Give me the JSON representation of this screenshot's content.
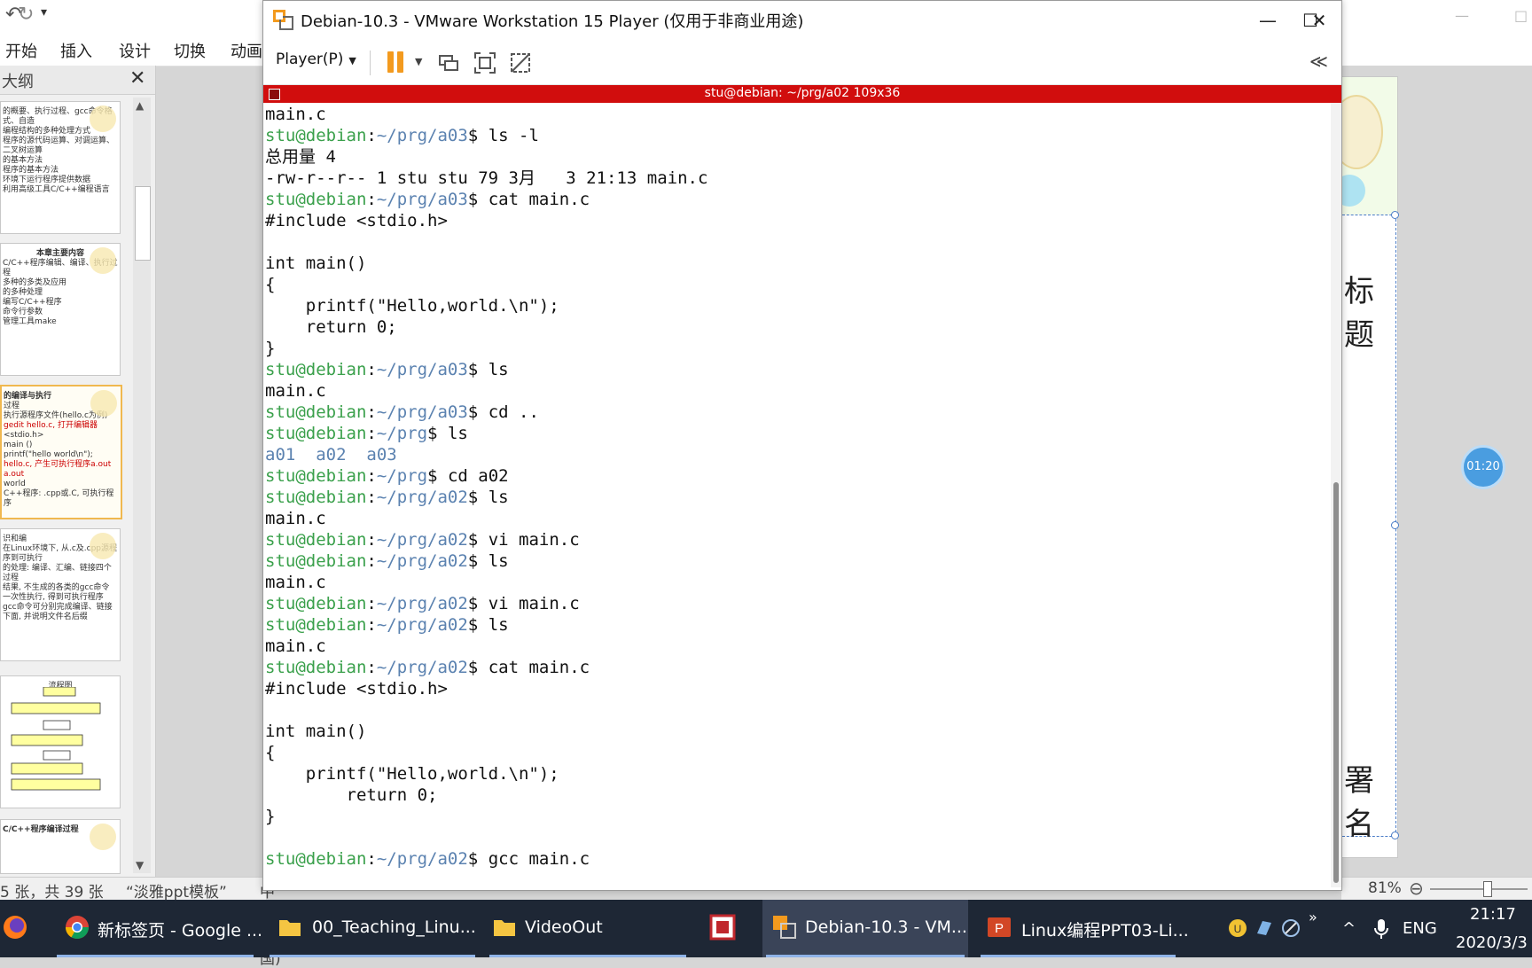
{
  "ppt": {
    "ribbon_tabs": [
      "开始",
      "插入",
      "设计",
      "切换",
      "动画"
    ],
    "outline_tab_label": "大纲",
    "thumbnails": [
      {
        "lines": [
          "的概要、执行过程、gcc命令格式、自造",
          "编程结构的多种处理方式",
          "程序的源代码运算、对调运算、二叉树运算",
          "的基本方法",
          "程序的基本方法",
          "环境下运行程序提供数据",
          "利用高级工具C/C++编程语言"
        ]
      },
      {
        "lines": [
          "本章主要内容",
          "C/C++程序编辑、编译、执行过程",
          "多种的多类及应用",
          "的多种处理",
          "编写C/C++程序",
          "命令行参数",
          "管理工具make"
        ]
      },
      {
        "lines": [
          "的编译与执行",
          "过程",
          "执行源程序文件(hello.c为例)",
          "gedit hello.c, 打开编辑器",
          "<stdio.h>",
          "main ()",
          "printf(\"hello world\\n\");",
          "hello.c, 产生可执行程序a.out",
          "a.out",
          "world",
          "C++程序: .cpp或.C, 可执行程序"
        ]
      },
      {
        "lines": [
          "识和编",
          "在Linux环境下, 从.c及.cpp源程序到可执行",
          "的处理: 编译、汇编、链接四个过程",
          "结果, 不生成的各类的gcc命令",
          "一次性执行, 得到可执行程序",
          "gcc命令可分别完成编译、链接",
          "下面, 并说明文件名后缀"
        ]
      },
      {
        "lines": [
          "流程图"
        ]
      },
      {
        "lines": [
          "C/C++程序编译过程"
        ]
      }
    ],
    "status": {
      "slide_count": "5 张，共 39 张",
      "template": "“淡雅ppt模板”",
      "language": "中文(中国)"
    },
    "slide_text_1": "标题",
    "slide_text_2": "署名",
    "timer_text": "01:20",
    "zoom": "81%"
  },
  "vmware": {
    "title": "Debian-10.3 - VMware Workstation 15 Player (仅用于非商业用途)",
    "player_menu": "Player(P)",
    "guest_bar_title": "stu@debian: ~/prg/a02 109x36",
    "colors": {
      "guest_bar": "#d10d0d",
      "prompt_user": "#3aa04b",
      "prompt_path": "#5b82b0",
      "pause": "#f39a1e"
    }
  },
  "terminal": {
    "lines": [
      {
        "type": "out",
        "text": "main.c"
      },
      {
        "type": "prompt",
        "user": "stu@debian",
        "path": "~/prg/a03",
        "cmd": " ls -l"
      },
      {
        "type": "out",
        "text": "总用量 4"
      },
      {
        "type": "out",
        "text": "-rw-r--r-- 1 stu stu 79 3月   3 21:13 main.c"
      },
      {
        "type": "prompt",
        "user": "stu@debian",
        "path": "~/prg/a03",
        "cmd": " cat main.c"
      },
      {
        "type": "out",
        "text": "#include <stdio.h>"
      },
      {
        "type": "out",
        "text": ""
      },
      {
        "type": "out",
        "text": "int main()"
      },
      {
        "type": "out",
        "text": "{"
      },
      {
        "type": "out",
        "text": "    printf(\"Hello,world.\\n\");"
      },
      {
        "type": "out",
        "text": "    return 0;"
      },
      {
        "type": "out",
        "text": "}"
      },
      {
        "type": "prompt",
        "user": "stu@debian",
        "path": "~/prg/a03",
        "cmd": " ls"
      },
      {
        "type": "out",
        "text": "main.c"
      },
      {
        "type": "prompt",
        "user": "stu@debian",
        "path": "~/prg/a03",
        "cmd": " cd .."
      },
      {
        "type": "prompt",
        "user": "stu@debian",
        "path": "~/prg",
        "cmd": " ls"
      },
      {
        "type": "dir",
        "text": "a01  a02  a03"
      },
      {
        "type": "prompt",
        "user": "stu@debian",
        "path": "~/prg",
        "cmd": " cd a02"
      },
      {
        "type": "prompt",
        "user": "stu@debian",
        "path": "~/prg/a02",
        "cmd": " ls"
      },
      {
        "type": "out",
        "text": "main.c"
      },
      {
        "type": "prompt",
        "user": "stu@debian",
        "path": "~/prg/a02",
        "cmd": " vi main.c"
      },
      {
        "type": "prompt",
        "user": "stu@debian",
        "path": "~/prg/a02",
        "cmd": " ls"
      },
      {
        "type": "out",
        "text": "main.c"
      },
      {
        "type": "prompt",
        "user": "stu@debian",
        "path": "~/prg/a02",
        "cmd": " vi main.c"
      },
      {
        "type": "prompt",
        "user": "stu@debian",
        "path": "~/prg/a02",
        "cmd": " ls"
      },
      {
        "type": "out",
        "text": "main.c"
      },
      {
        "type": "prompt",
        "user": "stu@debian",
        "path": "~/prg/a02",
        "cmd": " cat main.c"
      },
      {
        "type": "out",
        "text": "#include <stdio.h>"
      },
      {
        "type": "out",
        "text": ""
      },
      {
        "type": "out",
        "text": "int main()"
      },
      {
        "type": "out",
        "text": "{"
      },
      {
        "type": "out",
        "text": "    printf(\"Hello,world.\\n\");"
      },
      {
        "type": "out",
        "text": "        return 0;"
      },
      {
        "type": "out",
        "text": "}"
      },
      {
        "type": "out",
        "text": ""
      },
      {
        "type": "prompt",
        "user": "stu@debian",
        "path": "~/prg/a02",
        "cmd": " gcc main.c"
      }
    ]
  },
  "taskbar": {
    "items": [
      {
        "icon": "firefox-icon",
        "label": ""
      },
      {
        "icon": "chrome-icon",
        "label": "新标签页 - Google ..."
      },
      {
        "icon": "folder-icon",
        "label": "00_Teaching_Linu..."
      },
      {
        "icon": "folder-icon",
        "label": "VideoOut"
      },
      {
        "icon": "screen-recorder-icon",
        "label": ""
      },
      {
        "icon": "vmware-icon",
        "label": "Debian-10.3 - VM..."
      },
      {
        "icon": "powerpoint-icon",
        "label": "Linux编程PPT03-Li..."
      }
    ],
    "tray": {
      "expand": "»",
      "chevron": "^",
      "lang": "ENG",
      "time": "21:17",
      "date": "2020/3/3"
    }
  }
}
